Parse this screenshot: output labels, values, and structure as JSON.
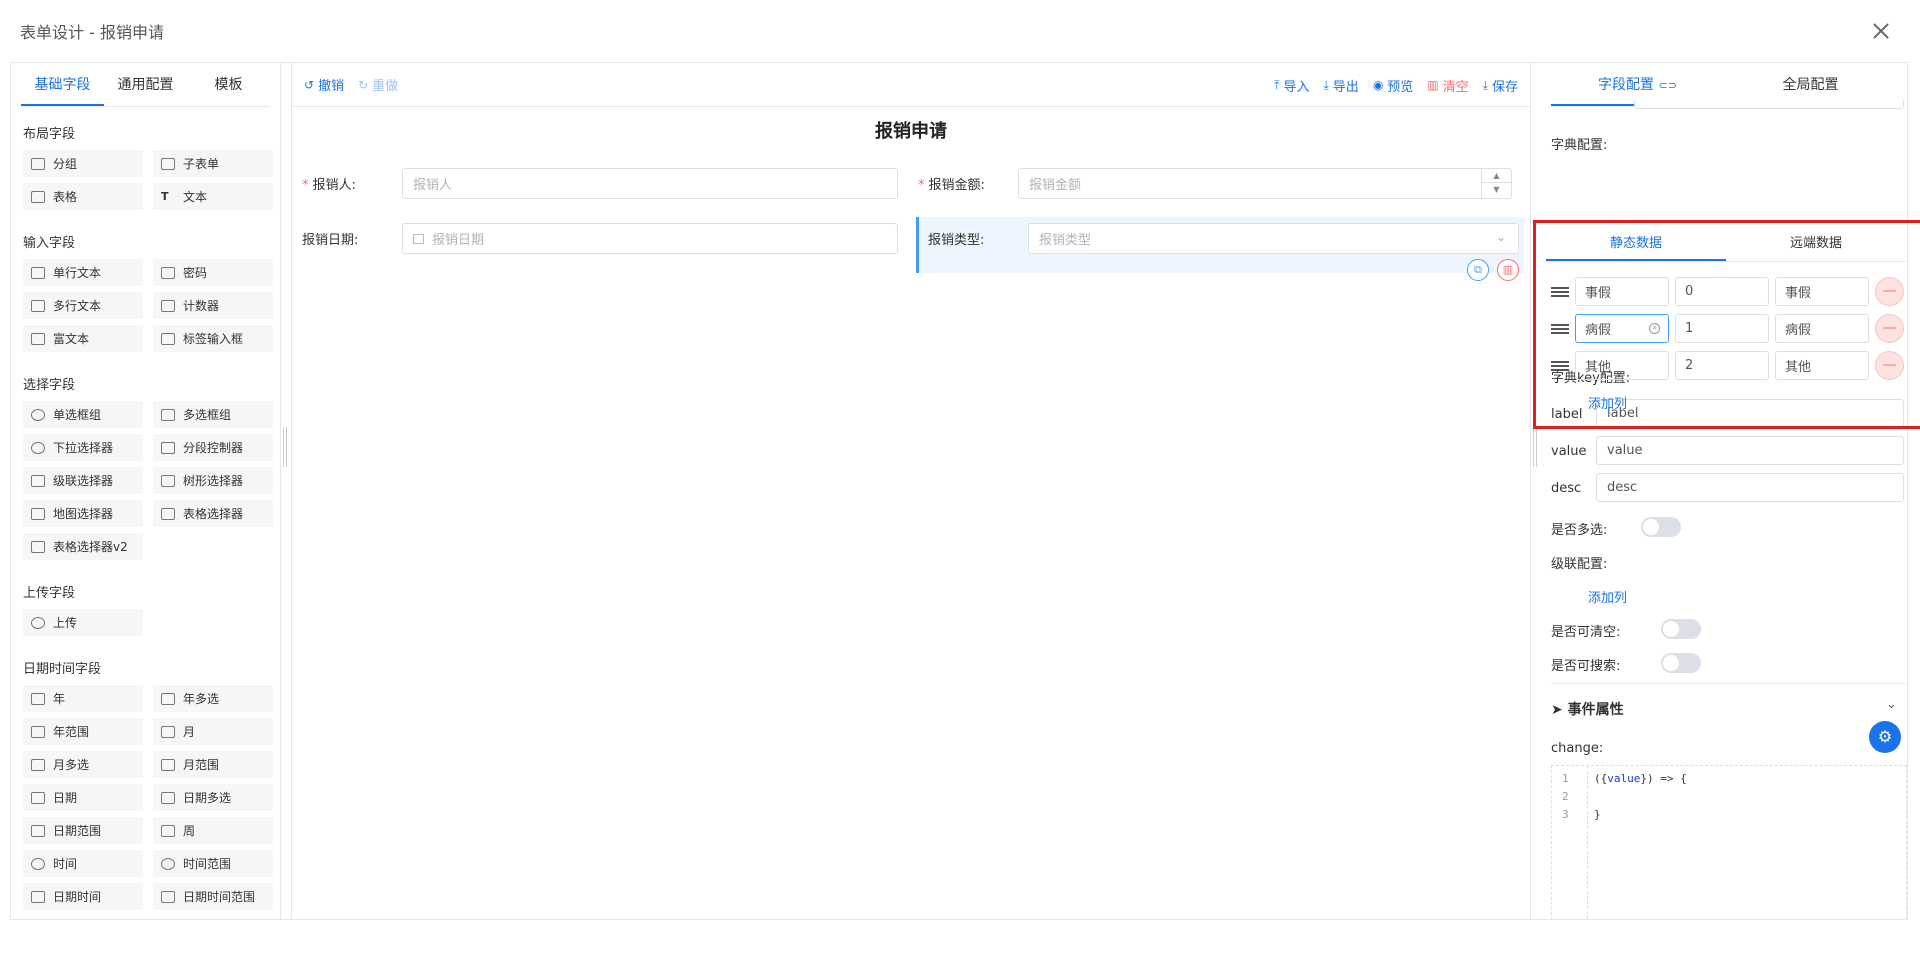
{
  "window": {
    "title": "表单设计 - 报销申请"
  },
  "left": {
    "tabs": [
      "基础字段",
      "通用配置",
      "模板"
    ],
    "sections": [
      {
        "title": "布局字段",
        "items": [
          "分组",
          "子表单",
          "表格",
          "文本"
        ]
      },
      {
        "title": "输入字段",
        "items": [
          "单行文本",
          "密码",
          "多行文本",
          "计数器",
          "富文本",
          "标签输入框"
        ]
      },
      {
        "title": "选择字段",
        "items": [
          "单选框组",
          "多选框组",
          "下拉选择器",
          "分段控制器",
          "级联选择器",
          "树形选择器",
          "地图选择器",
          "表格选择器",
          "表格选择器v2"
        ]
      },
      {
        "title": "上传字段",
        "items": [
          "上传"
        ]
      },
      {
        "title": "日期时间字段",
        "items": [
          "年",
          "年多选",
          "年范围",
          "月",
          "月多选",
          "月范围",
          "日期",
          "日期多选",
          "日期范围",
          "周",
          "时间",
          "时间范围",
          "日期时间",
          "日期时间范围"
        ]
      }
    ]
  },
  "toolbar": {
    "undo": "撤销",
    "redo": "重做",
    "import": "导入",
    "export": "导出",
    "preview": "预览",
    "clear": "清空",
    "save": "保存"
  },
  "form": {
    "title": "报销申请",
    "fields": [
      {
        "label": "报销人:",
        "placeholder": "报销人",
        "required": "*"
      },
      {
        "label": "报销金额:",
        "placeholder": "报销金额",
        "required": "*"
      },
      {
        "label": "报销日期:",
        "placeholder": "报销日期"
      },
      {
        "label": "报销类型:",
        "placeholder": "报销类型"
      }
    ]
  },
  "right": {
    "tabs": [
      "字段配置",
      "全局配置"
    ],
    "dict_label": "字典配置:",
    "subtabs": [
      "静态数据",
      "远端数据"
    ],
    "rows": [
      {
        "label": "事假",
        "value": "0",
        "desc": "事假"
      },
      {
        "label": "病假",
        "value": "1",
        "desc": "病假"
      },
      {
        "label": "其他",
        "value": "2",
        "desc": "其他"
      }
    ],
    "add_col": "添加列",
    "key_label": "字典key配置:",
    "keys": [
      {
        "name": "label",
        "value": "label"
      },
      {
        "name": "value",
        "value": "value"
      },
      {
        "name": "desc",
        "value": "desc"
      }
    ],
    "multi_label": "是否多选:",
    "cascade_label": "级联配置:",
    "add_col2": "添加列",
    "clearable_label": "是否可清空:",
    "searchable_label": "是否可搜索:",
    "events_title": "事件属性",
    "change_label": "change:",
    "code": {
      "l1": "1",
      "l2": "2",
      "l3": "3",
      "c1a": "({",
      "c1b": "value",
      "c1c": "}) => {",
      "c3": "}"
    }
  }
}
